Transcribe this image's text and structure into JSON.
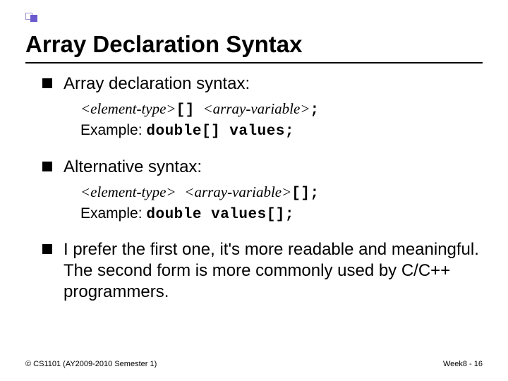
{
  "title": "Array Declaration Syntax",
  "bullets": {
    "b1": {
      "head": "Array declaration syntax:",
      "syntax_italic_pre": "<element-type>",
      "syntax_mono_mid": "[]",
      "syntax_italic_post": "<array-variable>",
      "syntax_mono_semi": ";",
      "example_label": "Example: ",
      "example_code": "double[] values;"
    },
    "b2": {
      "head": "Alternative syntax:",
      "syntax_italic_pre": "<element-type>",
      "syntax_italic_post": "<array-variable>",
      "syntax_mono_tail": "[];",
      "example_label": "Example: ",
      "example_code": "double values[];"
    },
    "b3": {
      "text": "I prefer the first one, it's more readable and meaningful. The second form is more commonly used by C/C++ programmers."
    }
  },
  "footer": {
    "left": "© CS1101 (AY2009-2010 Semester 1)",
    "right": "Week8 - 16"
  }
}
